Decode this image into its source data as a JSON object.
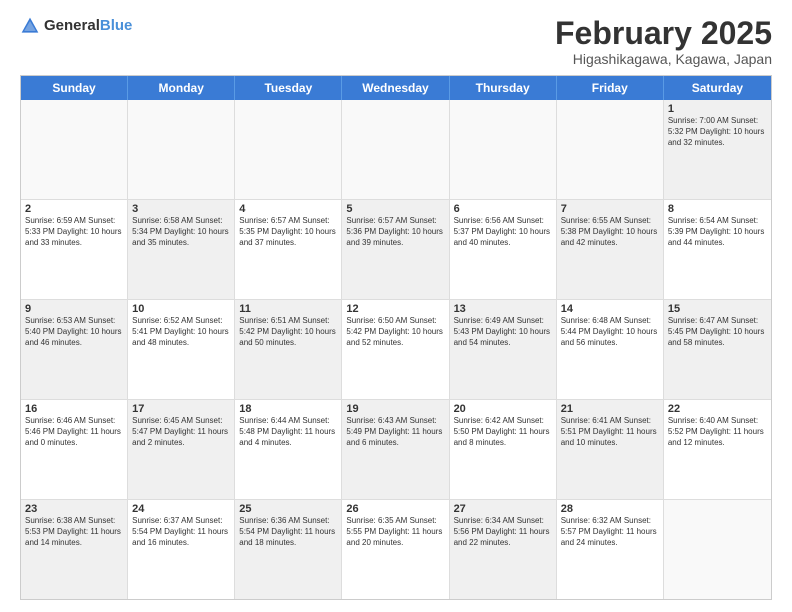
{
  "header": {
    "logo_general": "General",
    "logo_blue": "Blue",
    "title": "February 2025",
    "subtitle": "Higashikagawa, Kagawa, Japan"
  },
  "weekdays": [
    "Sunday",
    "Monday",
    "Tuesday",
    "Wednesday",
    "Thursday",
    "Friday",
    "Saturday"
  ],
  "rows": [
    [
      {
        "day": "",
        "text": "",
        "empty": true
      },
      {
        "day": "",
        "text": "",
        "empty": true
      },
      {
        "day": "",
        "text": "",
        "empty": true
      },
      {
        "day": "",
        "text": "",
        "empty": true
      },
      {
        "day": "",
        "text": "",
        "empty": true
      },
      {
        "day": "",
        "text": "",
        "empty": true
      },
      {
        "day": "1",
        "text": "Sunrise: 7:00 AM\nSunset: 5:32 PM\nDaylight: 10 hours\nand 32 minutes.",
        "shaded": true
      }
    ],
    [
      {
        "day": "2",
        "text": "Sunrise: 6:59 AM\nSunset: 5:33 PM\nDaylight: 10 hours\nand 33 minutes.",
        "shaded": false
      },
      {
        "day": "3",
        "text": "Sunrise: 6:58 AM\nSunset: 5:34 PM\nDaylight: 10 hours\nand 35 minutes.",
        "shaded": true
      },
      {
        "day": "4",
        "text": "Sunrise: 6:57 AM\nSunset: 5:35 PM\nDaylight: 10 hours\nand 37 minutes.",
        "shaded": false
      },
      {
        "day": "5",
        "text": "Sunrise: 6:57 AM\nSunset: 5:36 PM\nDaylight: 10 hours\nand 39 minutes.",
        "shaded": true
      },
      {
        "day": "6",
        "text": "Sunrise: 6:56 AM\nSunset: 5:37 PM\nDaylight: 10 hours\nand 40 minutes.",
        "shaded": false
      },
      {
        "day": "7",
        "text": "Sunrise: 6:55 AM\nSunset: 5:38 PM\nDaylight: 10 hours\nand 42 minutes.",
        "shaded": true
      },
      {
        "day": "8",
        "text": "Sunrise: 6:54 AM\nSunset: 5:39 PM\nDaylight: 10 hours\nand 44 minutes.",
        "shaded": false
      }
    ],
    [
      {
        "day": "9",
        "text": "Sunrise: 6:53 AM\nSunset: 5:40 PM\nDaylight: 10 hours\nand 46 minutes.",
        "shaded": true
      },
      {
        "day": "10",
        "text": "Sunrise: 6:52 AM\nSunset: 5:41 PM\nDaylight: 10 hours\nand 48 minutes.",
        "shaded": false
      },
      {
        "day": "11",
        "text": "Sunrise: 6:51 AM\nSunset: 5:42 PM\nDaylight: 10 hours\nand 50 minutes.",
        "shaded": true
      },
      {
        "day": "12",
        "text": "Sunrise: 6:50 AM\nSunset: 5:42 PM\nDaylight: 10 hours\nand 52 minutes.",
        "shaded": false
      },
      {
        "day": "13",
        "text": "Sunrise: 6:49 AM\nSunset: 5:43 PM\nDaylight: 10 hours\nand 54 minutes.",
        "shaded": true
      },
      {
        "day": "14",
        "text": "Sunrise: 6:48 AM\nSunset: 5:44 PM\nDaylight: 10 hours\nand 56 minutes.",
        "shaded": false
      },
      {
        "day": "15",
        "text": "Sunrise: 6:47 AM\nSunset: 5:45 PM\nDaylight: 10 hours\nand 58 minutes.",
        "shaded": true
      }
    ],
    [
      {
        "day": "16",
        "text": "Sunrise: 6:46 AM\nSunset: 5:46 PM\nDaylight: 11 hours\nand 0 minutes.",
        "shaded": false
      },
      {
        "day": "17",
        "text": "Sunrise: 6:45 AM\nSunset: 5:47 PM\nDaylight: 11 hours\nand 2 minutes.",
        "shaded": true
      },
      {
        "day": "18",
        "text": "Sunrise: 6:44 AM\nSunset: 5:48 PM\nDaylight: 11 hours\nand 4 minutes.",
        "shaded": false
      },
      {
        "day": "19",
        "text": "Sunrise: 6:43 AM\nSunset: 5:49 PM\nDaylight: 11 hours\nand 6 minutes.",
        "shaded": true
      },
      {
        "day": "20",
        "text": "Sunrise: 6:42 AM\nSunset: 5:50 PM\nDaylight: 11 hours\nand 8 minutes.",
        "shaded": false
      },
      {
        "day": "21",
        "text": "Sunrise: 6:41 AM\nSunset: 5:51 PM\nDaylight: 11 hours\nand 10 minutes.",
        "shaded": true
      },
      {
        "day": "22",
        "text": "Sunrise: 6:40 AM\nSunset: 5:52 PM\nDaylight: 11 hours\nand 12 minutes.",
        "shaded": false
      }
    ],
    [
      {
        "day": "23",
        "text": "Sunrise: 6:38 AM\nSunset: 5:53 PM\nDaylight: 11 hours\nand 14 minutes.",
        "shaded": true
      },
      {
        "day": "24",
        "text": "Sunrise: 6:37 AM\nSunset: 5:54 PM\nDaylight: 11 hours\nand 16 minutes.",
        "shaded": false
      },
      {
        "day": "25",
        "text": "Sunrise: 6:36 AM\nSunset: 5:54 PM\nDaylight: 11 hours\nand 18 minutes.",
        "shaded": true
      },
      {
        "day": "26",
        "text": "Sunrise: 6:35 AM\nSunset: 5:55 PM\nDaylight: 11 hours\nand 20 minutes.",
        "shaded": false
      },
      {
        "day": "27",
        "text": "Sunrise: 6:34 AM\nSunset: 5:56 PM\nDaylight: 11 hours\nand 22 minutes.",
        "shaded": true
      },
      {
        "day": "28",
        "text": "Sunrise: 6:32 AM\nSunset: 5:57 PM\nDaylight: 11 hours\nand 24 minutes.",
        "shaded": false
      },
      {
        "day": "",
        "text": "",
        "empty": true
      }
    ]
  ]
}
